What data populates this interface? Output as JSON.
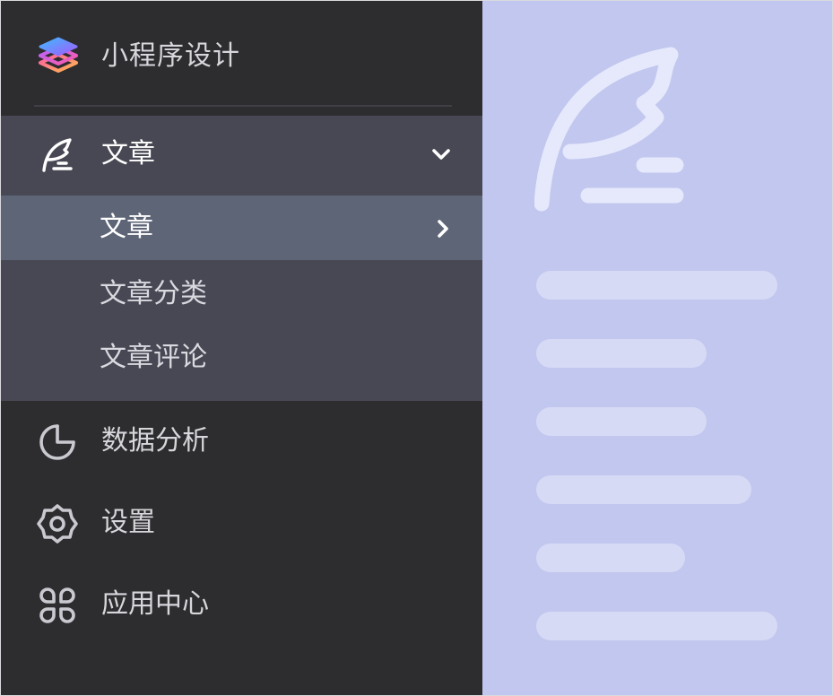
{
  "brand": {
    "title": "小程序设计",
    "logo_icon": "layers-icon"
  },
  "menu": {
    "articles": {
      "label": "文章",
      "icon": "feather-pen-icon",
      "expanded": true,
      "children": [
        {
          "label": "文章",
          "active": true
        },
        {
          "label": "文章分类",
          "active": false
        },
        {
          "label": "文章评论",
          "active": false
        }
      ]
    },
    "items": [
      {
        "label": "数据分析",
        "icon": "pie-chart-icon"
      },
      {
        "label": "设置",
        "icon": "gear-icon"
      },
      {
        "label": "应用中心",
        "icon": "app-grid-icon"
      }
    ]
  },
  "colors": {
    "sidebar_bg": "#2d2d30",
    "group_bg": "#474853",
    "active_bg": "#5e6577",
    "preview_bg": "#c1c7ee",
    "preview_bar": "#d7daf5"
  },
  "preview": {
    "icon": "feather-pen-icon",
    "placeholder_lines": 6
  }
}
